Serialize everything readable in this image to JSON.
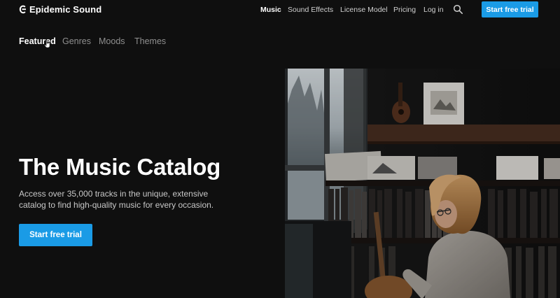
{
  "brand": {
    "name": "Epidemic Sound"
  },
  "nav": {
    "items": [
      {
        "label": "Music",
        "active": true
      },
      {
        "label": "Sound Effects",
        "active": false
      },
      {
        "label": "License Model",
        "active": false
      },
      {
        "label": "Pricing",
        "active": false
      },
      {
        "label": "Log in",
        "active": false
      }
    ],
    "search_icon": "search-icon",
    "cta_label": "Start free trial"
  },
  "subnav": {
    "items": [
      {
        "label": "Featured",
        "active": true
      },
      {
        "label": "Genres",
        "active": false
      },
      {
        "label": "Moods",
        "active": false
      },
      {
        "label": "Themes",
        "active": false
      }
    ]
  },
  "hero": {
    "title": "The Music Catalog",
    "description": "Access over 35,000 tracks in the unique, extensive catalog to find high-quality music for every occasion.",
    "cta_label": "Start free trial",
    "image_icon": "woman-playing-guitar-photo"
  },
  "colors": {
    "background": "#0f0f0f",
    "accent": "#1a9be6",
    "text": "#ffffff",
    "muted": "#8f8f8f"
  }
}
